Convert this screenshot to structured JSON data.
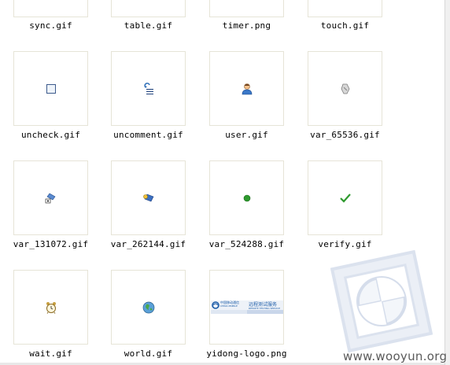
{
  "files": {
    "row0": [
      "sync.gif",
      "table.gif",
      "timer.png",
      "touch.gif"
    ],
    "row1": [
      "uncheck.gif",
      "uncomment.gif",
      "user.gif",
      "var_65536.gif"
    ],
    "row2": [
      "var_131072.gif",
      "var_262144.gif",
      "var_524288.gif",
      "verify.gif"
    ],
    "row3": [
      "wait.gif",
      "world.gif",
      "yidong-logo.png"
    ]
  },
  "logo": {
    "chinese_left": "中国移动通信",
    "english_left": "CHINA MOBILE",
    "chinese_right": "远程测试服务",
    "english_right": "REMOTE TESTING SERVICE"
  },
  "watermark": {
    "text": "www.wooyun.org"
  },
  "icons": {
    "uncheck": "checkbox-icon",
    "uncomment": "uncomment-icon",
    "user": "user-icon",
    "var_65536": "variable-icon",
    "var_131072": "variable-icon",
    "var_262144": "variable-icon",
    "var_524288": "dot-icon",
    "verify": "checkmark-icon",
    "wait": "alarm-clock-icon",
    "world": "globe-icon"
  }
}
